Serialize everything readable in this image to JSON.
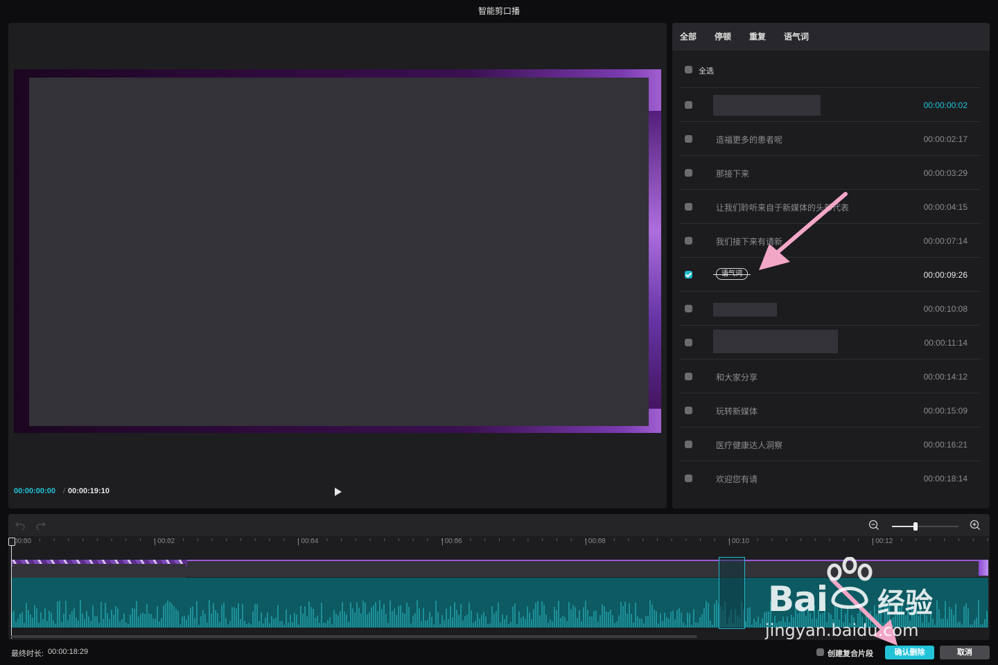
{
  "window": {
    "title": "智能剪口播"
  },
  "preview": {
    "current_time": "00:00:00:00",
    "separator": "/",
    "total_time": "00:00:19:10"
  },
  "tabs": [
    {
      "label": "全部",
      "active": true
    },
    {
      "label": "停顿",
      "active": false
    },
    {
      "label": "重复",
      "active": false
    },
    {
      "label": "语气词",
      "active": false
    }
  ],
  "select_all": {
    "label": "全选",
    "checked": false
  },
  "rows": [
    {
      "text": "",
      "redacted": true,
      "time": "00:00:00:02",
      "checked": false
    },
    {
      "text": "造福更多的患者呢",
      "time": "00:00:02:17",
      "checked": false
    },
    {
      "text": "那接下来",
      "time": "00:00:03:29",
      "checked": false
    },
    {
      "text": "让我们聆听来自于新媒体的头部代表",
      "time": "00:00:04:15",
      "checked": false
    },
    {
      "text": "我们接下来有请新",
      "time": "00:00:07:14",
      "checked": false
    },
    {
      "text": "语气词",
      "chip": true,
      "time": "00:00:09:26",
      "checked": true
    },
    {
      "text": "",
      "redacted": true,
      "time": "00:00:10:08",
      "checked": false
    },
    {
      "text": "",
      "redacted": true,
      "time": "00:00:11:14",
      "checked": false
    },
    {
      "text": "和大家分享",
      "time": "00:00:14:12",
      "checked": false
    },
    {
      "text": "玩转新媒体",
      "time": "00:00:15:09",
      "checked": false
    },
    {
      "text": "医疗健康达人洞察",
      "time": "00:00:16:21",
      "checked": false
    },
    {
      "text": "欢迎您有请",
      "time": "00:00:18:14",
      "checked": false
    }
  ],
  "timeline": {
    "ruler": [
      "00:00",
      "00:02",
      "00:04",
      "00:06",
      "00:08",
      "00:10",
      "00:12"
    ],
    "zoom_level": 0.22
  },
  "footer": {
    "final_duration_label": "最终时长:",
    "final_duration_value": "00:00:18:29",
    "compound_label": "创建复合片段",
    "compound_checked": false,
    "confirm_label": "确认删除",
    "cancel_label": "取消"
  },
  "watermark": {
    "brand": "Bai",
    "brand_cn": "经验",
    "url": "jingyan.baidu.com"
  },
  "colors": {
    "accent": "#1fc4d7",
    "annotation_arrow": "#f3a7c6"
  }
}
